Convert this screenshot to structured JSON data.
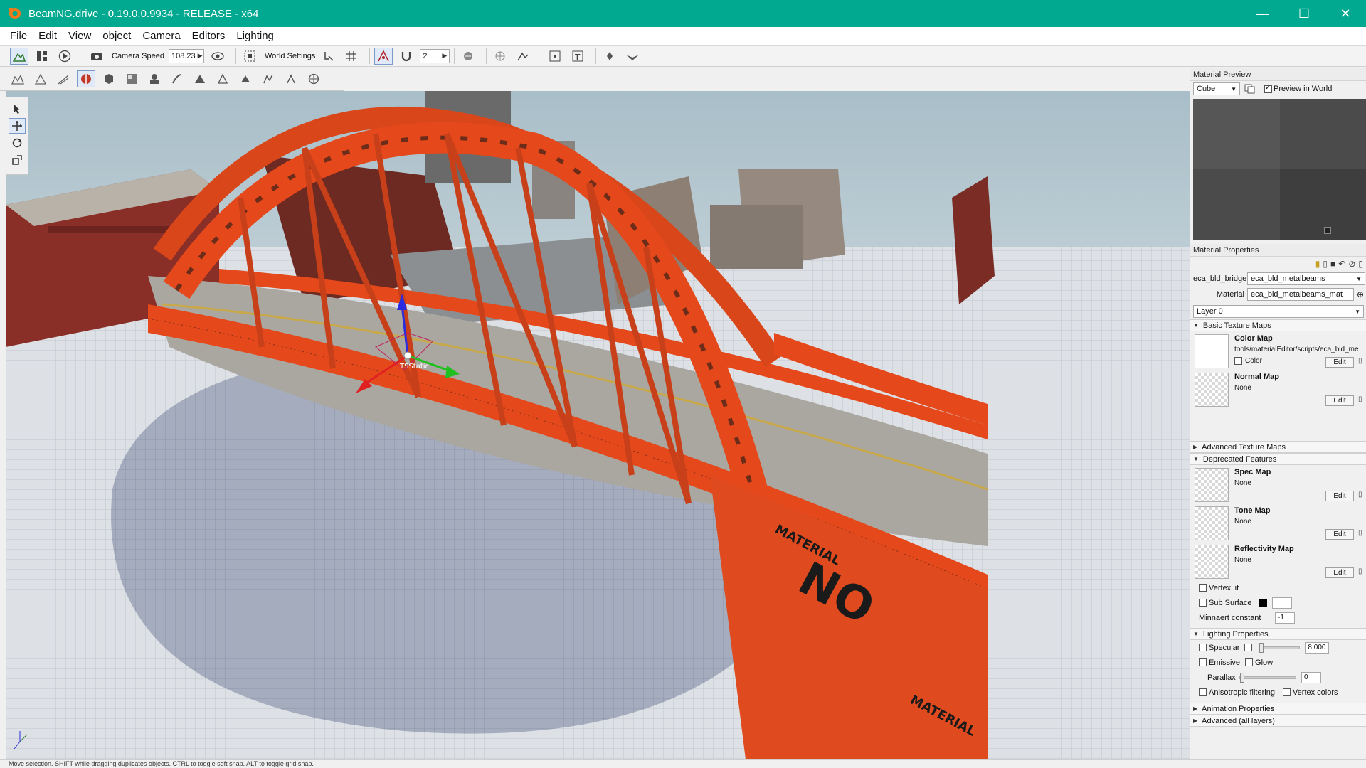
{
  "window": {
    "title": "BeamNG.drive - 0.19.0.0.9934 - RELEASE - x64",
    "controls": {
      "minimize": "—",
      "maximize": "☐",
      "close": "✕"
    }
  },
  "menu": [
    "File",
    "Edit",
    "View",
    "object",
    "Camera",
    "Editors",
    "Lighting"
  ],
  "toolbar": {
    "camera_speed_label": "Camera Speed",
    "camera_speed_value": "108.23",
    "world_settings_label": "World Settings",
    "grid_value": "2"
  },
  "viewport": {
    "gizmo_label": "TSStatic",
    "decal_text_1": "NO",
    "decal_text_2": "MATERIAL",
    "decal_text_3": "MATERIAL"
  },
  "statusbar": {
    "hint": "Move selection. SHIFT while dragging duplicates objects. CTRL to toggle soft snap. ALT to toggle grid snap."
  },
  "material_preview": {
    "header": "Material Preview",
    "shape": "Cube",
    "preview_in_world_label": "Preview in World",
    "preview_in_world_checked": true
  },
  "material_properties": {
    "header": "Material Properties",
    "mesh_label": "eca_bld_bridge",
    "mesh_value": "eca_bld_metalbeams",
    "material_label": "Material",
    "material_value": "eca_bld_metalbeams_mat",
    "layer": "Layer 0",
    "sections": {
      "basic_texture_maps": "Basic Texture Maps",
      "advanced_texture_maps": "Advanced Texture Maps",
      "deprecated_features": "Deprecated Features",
      "lighting_properties": "Lighting Properties",
      "animation_properties": "Animation Properties",
      "advanced_all_layers": "Advanced (all layers)"
    },
    "color_map": {
      "name": "Color Map",
      "path": "tools/materialEditor/scripts/eca_bld_me",
      "color_label": "Color",
      "edit": "Edit"
    },
    "normal_map": {
      "name": "Normal Map",
      "value": "None",
      "edit": "Edit"
    },
    "spec_map": {
      "name": "Spec Map",
      "value": "None",
      "edit": "Edit"
    },
    "tone_map": {
      "name": "Tone Map",
      "value": "None",
      "edit": "Edit"
    },
    "reflectivity_map": {
      "name": "Reflectivity Map",
      "value": "None",
      "edit": "Edit"
    },
    "vertex_lit_label": "Vertex lit",
    "sub_surface_label": "Sub Surface",
    "minnaert_label": "Minnaert constant",
    "minnaert_value": "-1",
    "specular_label": "Specular",
    "specular_value": "8.000",
    "emissive_label": "Emissive",
    "glow_label": "Glow",
    "parallax_label": "Parallax",
    "parallax_value": "0",
    "anisotropic_label": "Anisotropic filtering",
    "vertex_colors_label": "Vertex colors"
  },
  "colors": {
    "titlebar": "#00a98f",
    "bridge": "#e5481a",
    "sky": "#b8cbd3",
    "ground": "#d8dde3"
  }
}
